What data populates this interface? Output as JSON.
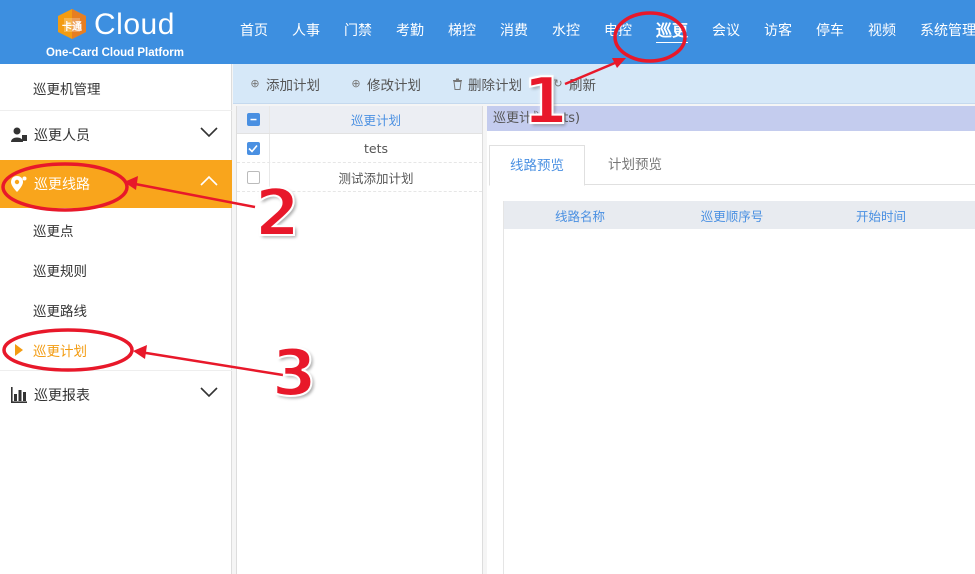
{
  "brand": {
    "name": "Cloud",
    "subtitle": "One-Card Cloud Platform",
    "mark_text": "卡通"
  },
  "topnav": {
    "items": [
      {
        "label": "首页"
      },
      {
        "label": "人事"
      },
      {
        "label": "门禁"
      },
      {
        "label": "考勤"
      },
      {
        "label": "梯控"
      },
      {
        "label": "消费"
      },
      {
        "label": "水控"
      },
      {
        "label": "电控"
      },
      {
        "label": "巡更",
        "active": true
      },
      {
        "label": "会议"
      },
      {
        "label": "访客"
      },
      {
        "label": "停车"
      },
      {
        "label": "视频"
      },
      {
        "label": "系统管理"
      }
    ]
  },
  "sidebar": {
    "items": [
      {
        "label": "巡更机管理"
      },
      {
        "label": "巡更人员",
        "icon": "user-tie-icon"
      },
      {
        "label": "巡更线路",
        "icon": "map-pin-icon",
        "active": true
      },
      {
        "label": "巡更点"
      },
      {
        "label": "巡更规则"
      },
      {
        "label": "巡更路线"
      },
      {
        "label": "巡更计划",
        "active": true
      },
      {
        "label": "巡更报表",
        "icon": "bar-chart-icon"
      }
    ]
  },
  "toolbar": {
    "add_label": "添加计划",
    "edit_label": "修改计划",
    "delete_label": "删除计划",
    "refresh_label": "刷新"
  },
  "plan_list": {
    "header": "巡更计划",
    "rows": [
      {
        "name": "tets",
        "checked": true
      },
      {
        "name": "测试添加计划",
        "checked": false
      }
    ]
  },
  "detail": {
    "title": "巡更计划(tets)",
    "tabs": [
      {
        "label": "线路预览",
        "active": true
      },
      {
        "label": "计划预览"
      }
    ],
    "columns": [
      "线路名称",
      "巡更顺序号",
      "开始时间"
    ]
  },
  "annotations": {
    "step1": "1",
    "step2": "2",
    "step3": "3"
  },
  "colors": {
    "header_blue": "#3d8fe0",
    "active_orange": "#f9a51c",
    "callout_red": "#e8182a",
    "link_blue": "#4a90e2"
  }
}
